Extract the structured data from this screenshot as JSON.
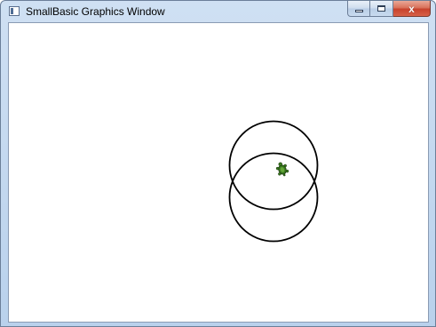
{
  "window": {
    "title": "SmallBasic Graphics Window",
    "icon": "app-window-icon",
    "buttons": {
      "minimize_icon": "minimize-icon",
      "maximize_icon": "maximize-icon",
      "close_icon": "close-icon",
      "close_glyph": "x"
    }
  },
  "canvas": {
    "background": "#ffffff",
    "stroke_color": "#000000",
    "turtle_color": "#3a7a1f",
    "turtle_icon": "turtle-icon"
  }
}
